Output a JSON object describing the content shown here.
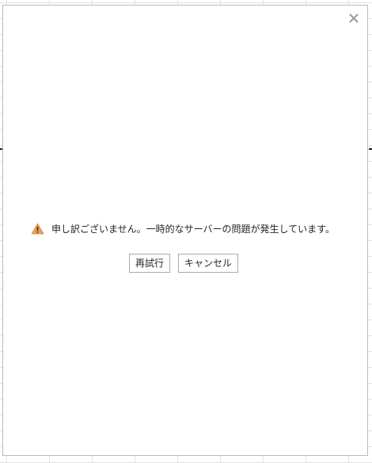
{
  "dialog": {
    "close_icon": "close-icon",
    "warning_icon": "warning-icon",
    "message": "申し訳ございません。一時的なサーバーの問題が発生しています。",
    "retry_label": "再試行",
    "cancel_label": "キャンセル"
  },
  "colors": {
    "warning": "#e8a05a",
    "border": "#b9b9b9",
    "gridline": "#e3e3e3"
  }
}
